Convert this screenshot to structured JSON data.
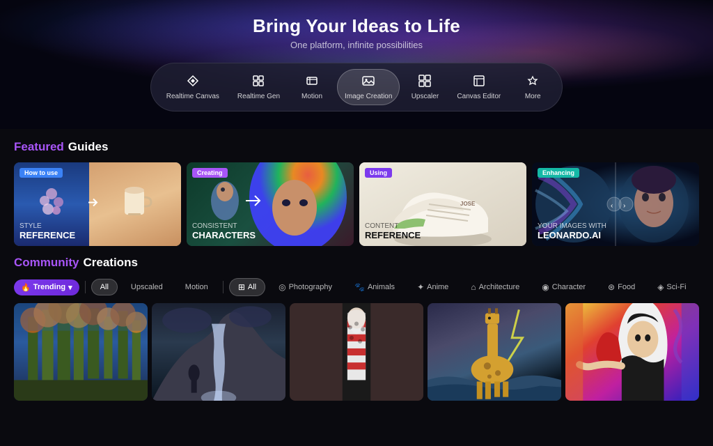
{
  "hero": {
    "title": "Bring Your Ideas to Life",
    "subtitle": "One platform, infinite possibilities",
    "bg_color": "#050510"
  },
  "nav": {
    "pills": [
      {
        "id": "realtime-canvas",
        "label": "Realtime Canvas",
        "icon": "✦",
        "active": false
      },
      {
        "id": "realtime-gen",
        "label": "Realtime Gen",
        "icon": "⊞",
        "active": false
      },
      {
        "id": "motion",
        "label": "Motion",
        "icon": "⊟",
        "active": false
      },
      {
        "id": "image-creation",
        "label": "Image Creation",
        "icon": "⊡",
        "active": true
      },
      {
        "id": "upscaler",
        "label": "Upscaler",
        "icon": "⊠",
        "active": false
      },
      {
        "id": "canvas-editor",
        "label": "Canvas Editor",
        "icon": "⊟",
        "active": false
      },
      {
        "id": "more",
        "label": "More",
        "icon": "✦",
        "active": false
      }
    ]
  },
  "featured": {
    "section_label_accent": "Featured",
    "section_label_rest": "Guides",
    "cards": [
      {
        "id": "style-reference",
        "tag": "How to use",
        "tag_color": "blue",
        "sub": "STYLE",
        "main": "REFERENCE"
      },
      {
        "id": "consistent-characters",
        "tag": "Creating",
        "tag_color": "purple",
        "sub": "CONSISTENT",
        "main": "CHARACTERS"
      },
      {
        "id": "content-reference",
        "tag": "Using",
        "tag_color": "violet",
        "sub": "CONTENT",
        "main": "REFERENCE"
      },
      {
        "id": "enhance-images",
        "tag": "Enhancing",
        "tag_color": "teal",
        "sub": "YOUR IMAGES WITH",
        "main": "LEONARDO.AI"
      }
    ]
  },
  "community": {
    "section_label_accent": "Community",
    "section_label_rest": "Creations",
    "trending_label": "Trending",
    "filters_main": [
      {
        "id": "all-main",
        "label": "All",
        "active": true,
        "icon": ""
      },
      {
        "id": "upscaled",
        "label": "Upscaled",
        "active": false,
        "icon": ""
      },
      {
        "id": "motion",
        "label": "Motion",
        "active": false,
        "icon": ""
      }
    ],
    "filters_category": [
      {
        "id": "all-cat",
        "label": "All",
        "active": true,
        "icon": "⊞"
      },
      {
        "id": "photography",
        "label": "Photography",
        "active": false,
        "icon": "◎"
      },
      {
        "id": "animals",
        "label": "Animals",
        "active": false,
        "icon": "🐾"
      },
      {
        "id": "anime",
        "label": "Anime",
        "active": false,
        "icon": "✦"
      },
      {
        "id": "architecture",
        "label": "Architecture",
        "active": false,
        "icon": "⌂"
      },
      {
        "id": "character",
        "label": "Character",
        "active": false,
        "icon": "◉"
      },
      {
        "id": "food",
        "label": "Food",
        "active": false,
        "icon": "⊛"
      },
      {
        "id": "sci-fi",
        "label": "Sci-Fi",
        "active": false,
        "icon": "◈"
      }
    ]
  },
  "colors": {
    "accent_purple": "#a855f7",
    "accent_blue": "#3b82f6",
    "accent_teal": "#14b8a6",
    "bg_dark": "#0a0a0f",
    "bg_card": "#1a1a2e",
    "tag_blue": "#3b82f6",
    "tag_purple": "#a855f7",
    "tag_violet": "#7c3aed",
    "tag_teal": "#14b8a6"
  }
}
